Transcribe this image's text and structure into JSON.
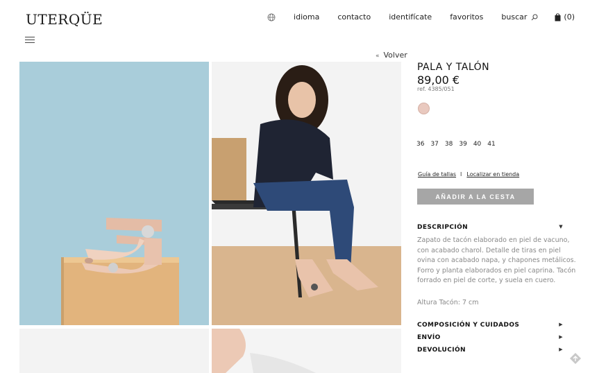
{
  "header": {
    "logo": "UTERQÜE",
    "nav": [
      {
        "label": "idioma"
      },
      {
        "label": "contacto"
      },
      {
        "label": "identifícate"
      },
      {
        "label": "favoritos"
      }
    ],
    "search_label": "buscar",
    "cart_count": "(0)"
  },
  "back_label": "Volver",
  "product": {
    "title": "PALA Y TALÓN",
    "price": "89,00  €",
    "ref": "ref. 4385/051",
    "color_swatch": "#e9c9bf",
    "sizes": [
      "36",
      "37",
      "38",
      "39",
      "40",
      "41"
    ],
    "size_guide": "Guía de tallas",
    "store_locator": "Localizar en tienda",
    "link_separator": "I",
    "add_to_cart": "AÑADIR A LA CESTA"
  },
  "sections": {
    "description_title": "DESCRIPCIÓN",
    "description_text": "Zapato de tacón elaborado en piel de vacuno, con acabado charol. Detalle de tiras en piel ovina con acabado napa, y chapones metálicos. Forro y planta elaborados en piel caprina. Tacón forrado en piel de corte, y suela en cuero.",
    "heel_height": "Altura Tacón: 7 cm",
    "composition_title": "COMPOSICIÓN Y CUIDADOS",
    "shipping_title": "ENVÍO",
    "returns_title": "DEVOLUCIÓN"
  },
  "colors": {
    "button_bg": "#a6a6a6",
    "photo1_bg": "#a9cdda",
    "text_muted": "#888888"
  }
}
